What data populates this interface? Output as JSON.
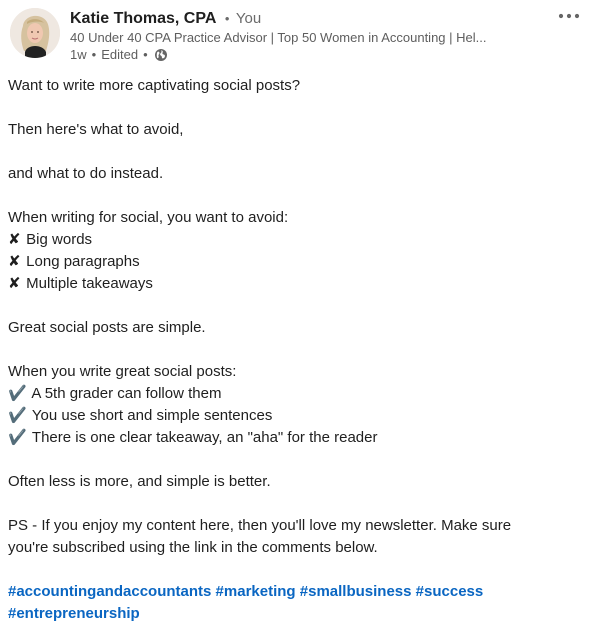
{
  "author": {
    "name": "Katie Thomas, CPA",
    "separator": "•",
    "you_label": "You",
    "headline": "40 Under 40 CPA Practice Advisor | Top 50 Women in Accounting | Hel...",
    "time": "1w",
    "edited": "Edited",
    "visibility_icon": "globe-icon"
  },
  "post": {
    "line1": "Want to write more captivating social posts?",
    "line2": "Then here's what to avoid,",
    "line3": "and what to do instead.",
    "avoid_intro": "When writing for social, you want to avoid:",
    "avoid_mark": "✘",
    "avoid_items": [
      "Big words",
      "Long paragraphs",
      "Multiple takeaways"
    ],
    "simple": "Great social posts are simple.",
    "do_intro": "When you write great social posts:",
    "do_mark": "✔️",
    "do_items": [
      "A 5th grader can follow them",
      "You use short and simple sentences",
      "There is one clear takeaway, an \"aha\" for the reader"
    ],
    "less_more": "Often less is more, and simple is better.",
    "ps_line1": "PS - If you enjoy my content here, then you'll love my newsletter. Make sure",
    "ps_line2": "you're subscribed using the link in the comments below.",
    "hashtags": [
      "#accountingandaccountants",
      "#marketing",
      "#smallbusiness",
      "#success",
      "#entrepreneurship"
    ]
  },
  "colors": {
    "link": "#0a66c2",
    "text": "#1f1f1f",
    "muted": "#5e5e5e"
  }
}
